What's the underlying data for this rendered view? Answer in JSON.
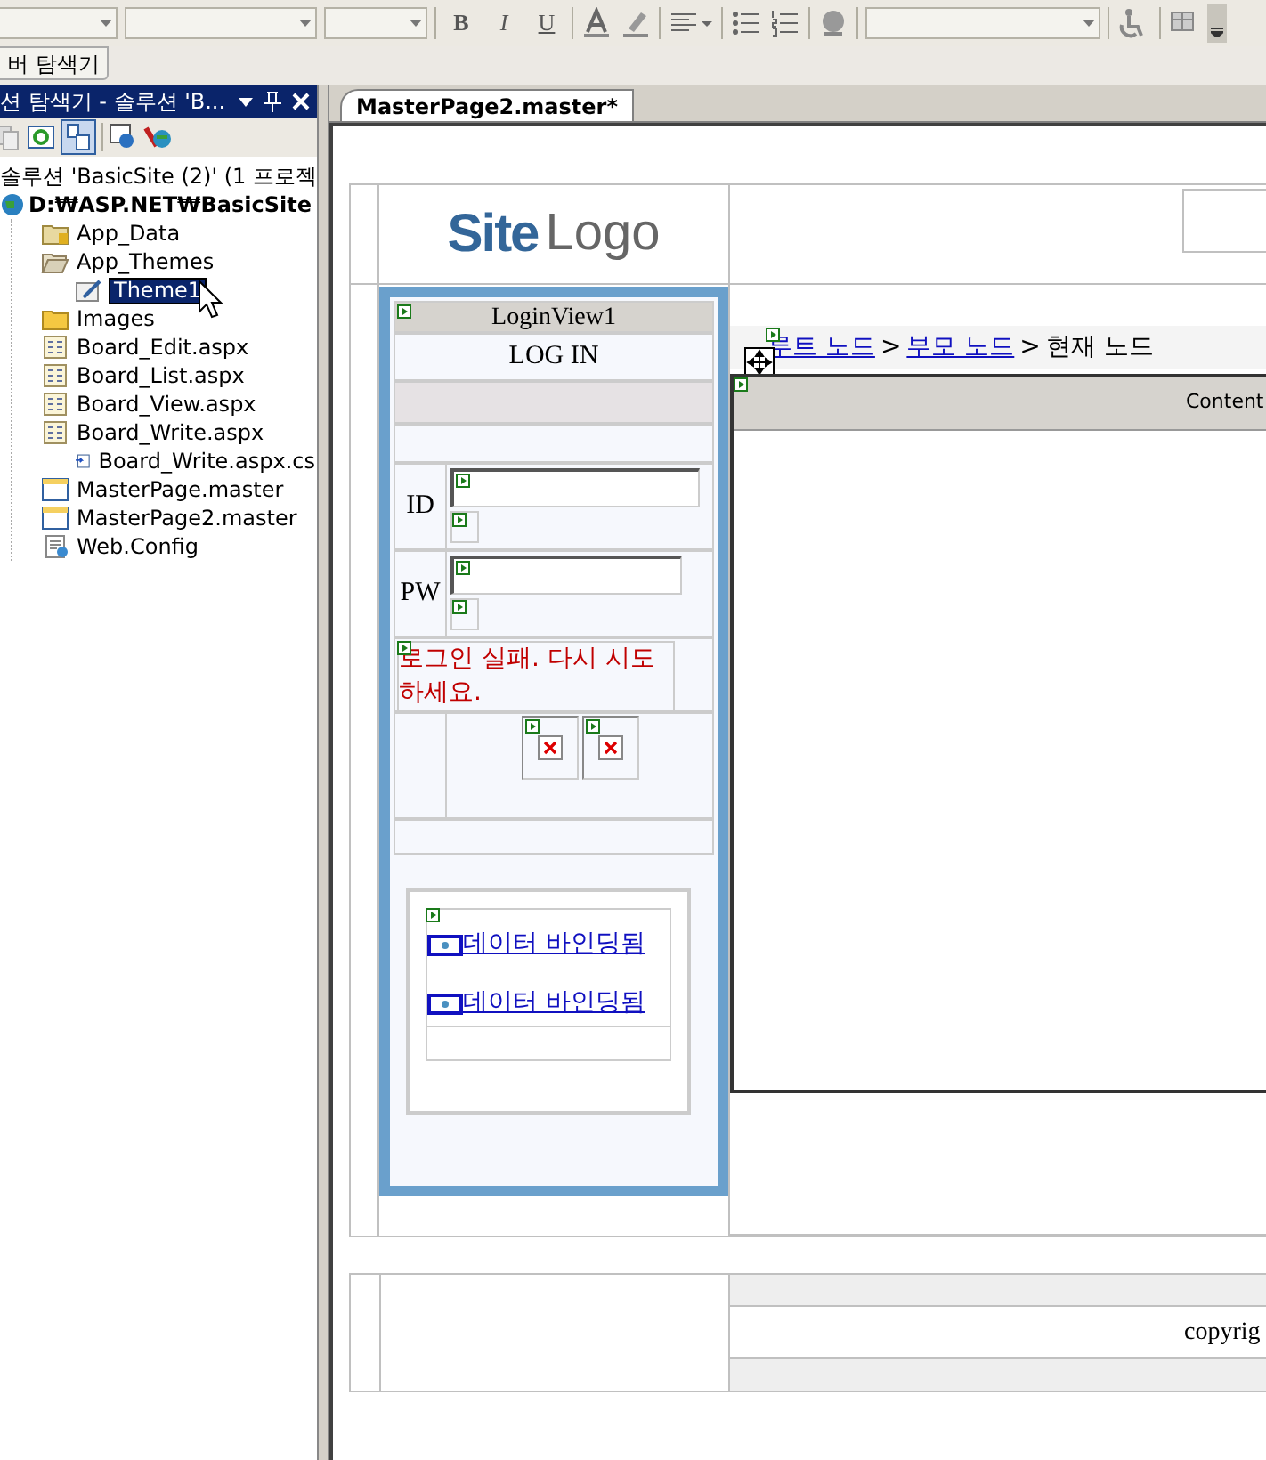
{
  "toolbar": {
    "format_buttons": [
      {
        "label": "B",
        "kind": "bold"
      },
      {
        "label": "I",
        "kind": "italic"
      },
      {
        "label": "U",
        "kind": "underline"
      }
    ]
  },
  "tool_window_tab": {
    "label": "버 탐색기"
  },
  "solution_explorer": {
    "title": "션 탐색기 - 솔루션 'B...",
    "solution": "솔루션 'BasicSite (2)' (1 프로젝",
    "project": "D:₩ASP.NET₩BasicSite",
    "items": [
      {
        "label": "App_Data",
        "kind": "datafolder",
        "selected": false
      },
      {
        "label": "App_Themes",
        "kind": "openfolder",
        "selected": false,
        "children": [
          {
            "label": "Theme1",
            "kind": "theme",
            "selected": true
          }
        ]
      },
      {
        "label": "Images",
        "kind": "folder",
        "selected": false
      },
      {
        "label": "Board_Edit.aspx",
        "kind": "page",
        "selected": false
      },
      {
        "label": "Board_List.aspx",
        "kind": "page",
        "selected": false
      },
      {
        "label": "Board_View.aspx",
        "kind": "page",
        "selected": false
      },
      {
        "label": "Board_Write.aspx",
        "kind": "page",
        "selected": false,
        "children": [
          {
            "label": "Board_Write.aspx.cs",
            "kind": "code",
            "selected": false
          }
        ]
      },
      {
        "label": "MasterPage.master",
        "kind": "master",
        "selected": false
      },
      {
        "label": "MasterPage2.master",
        "kind": "master",
        "selected": false
      },
      {
        "label": "Web.Config",
        "kind": "config",
        "selected": false
      }
    ]
  },
  "document_tabs": [
    {
      "label": "MasterPage2.master*",
      "selected": true
    }
  ],
  "design": {
    "logo": {
      "bold": "Site",
      "light": "Logo"
    },
    "login": {
      "title": "LoginView1",
      "heading": "LOG IN",
      "fields": [
        {
          "label": "ID"
        },
        {
          "label": "PW"
        }
      ],
      "error": "로그인 실패. 다시 시도하세요."
    },
    "data_list": [
      "데이터 바인딩됨",
      "데이터 바인딩됨"
    ],
    "breadcrumb": [
      {
        "label": "루트 노드",
        "kind": "link"
      },
      {
        "label": ">",
        "kind": "separator"
      },
      {
        "label": "부모 노드",
        "kind": "link"
      },
      {
        "label": ">",
        "kind": "separator"
      },
      {
        "label": "현재 노드",
        "kind": "current"
      }
    ],
    "content_placeholder": "Content",
    "footer": "copyrig"
  }
}
